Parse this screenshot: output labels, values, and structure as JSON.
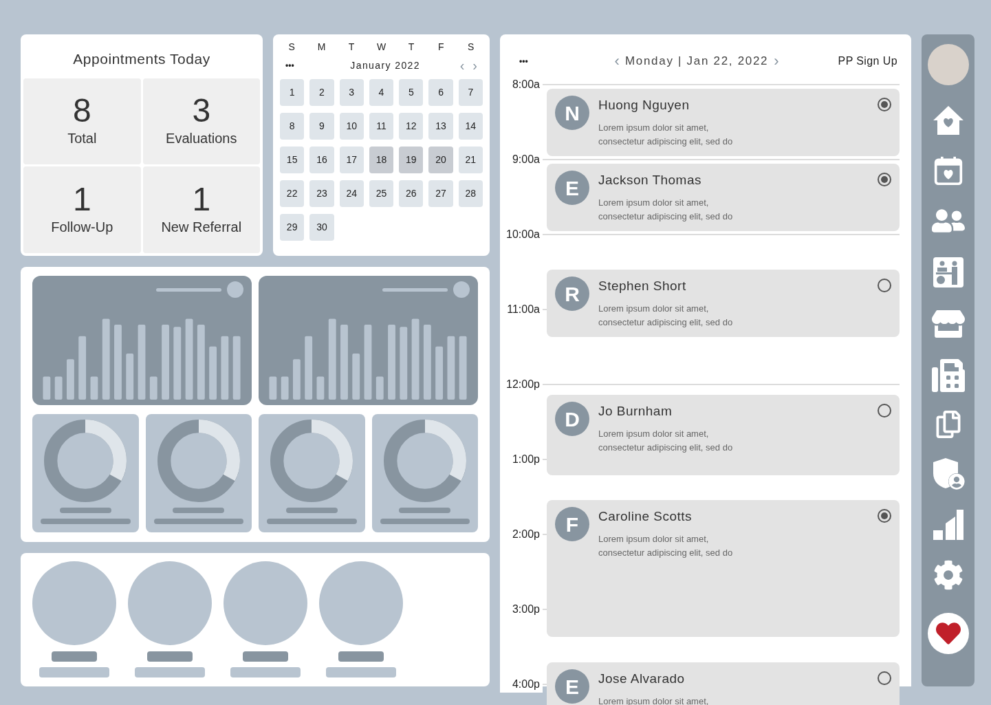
{
  "stats": {
    "title": "Appointments Today",
    "tiles": [
      {
        "value": "8",
        "label": "Total"
      },
      {
        "value": "3",
        "label": "Evaluations"
      },
      {
        "value": "1",
        "label": "Follow-Up"
      },
      {
        "value": "1",
        "label": "New Referral"
      }
    ]
  },
  "calendar": {
    "weekdays": [
      "S",
      "M",
      "T",
      "W",
      "T",
      "F",
      "S"
    ],
    "menu": "•••",
    "month": "January 2022",
    "prev": "‹",
    "next": "›",
    "days": [
      {
        "label": "1",
        "selected": false
      },
      {
        "label": "2",
        "selected": false
      },
      {
        "label": "3",
        "selected": false
      },
      {
        "label": "4",
        "selected": false
      },
      {
        "label": "5",
        "selected": false
      },
      {
        "label": "6",
        "selected": false
      },
      {
        "label": "7",
        "selected": false
      },
      {
        "label": "8",
        "selected": false
      },
      {
        "label": "9",
        "selected": false
      },
      {
        "label": "10",
        "selected": false
      },
      {
        "label": "11",
        "selected": false
      },
      {
        "label": "12",
        "selected": false
      },
      {
        "label": "13",
        "selected": false
      },
      {
        "label": "14",
        "selected": false
      },
      {
        "label": "15",
        "selected": false
      },
      {
        "label": "16",
        "selected": false
      },
      {
        "label": "17",
        "selected": false
      },
      {
        "label": "18",
        "selected": true
      },
      {
        "label": "19",
        "selected": true
      },
      {
        "label": "20",
        "selected": true
      },
      {
        "label": "21",
        "selected": false
      },
      {
        "label": "22",
        "selected": false
      },
      {
        "label": "23",
        "selected": false
      },
      {
        "label": "24",
        "selected": false
      },
      {
        "label": "25",
        "selected": false
      },
      {
        "label": "26",
        "selected": false
      },
      {
        "label": "27",
        "selected": false
      },
      {
        "label": "28",
        "selected": false
      },
      {
        "label": "29",
        "selected": false
      },
      {
        "label": "30",
        "selected": false
      }
    ]
  },
  "schedule": {
    "menu": "•••",
    "prev": "‹",
    "date": "Monday | Jan 22, 2022",
    "next": "›",
    "action": "PP Sign Up",
    "hours": [
      "8:00a",
      "9:00a",
      "10:00a",
      "11:00a",
      "12:00p",
      "1:00p",
      "2:00p",
      "3:00p",
      "4:00p"
    ],
    "appointments": [
      {
        "initial": "N",
        "name": "Huong Nguyen",
        "note": "Lorem ipsum dolor sit amet,\nconsectetur adipiscing elit, sed do",
        "checked": true
      },
      {
        "initial": "E",
        "name": "Jackson Thomas",
        "note": "Lorem ipsum dolor sit amet,\nconsectetur adipiscing elit, sed do",
        "checked": true
      },
      {
        "initial": "R",
        "name": "Stephen Short",
        "note": "Lorem ipsum dolor sit amet,\nconsectetur adipiscing elit, sed do",
        "checked": false
      },
      {
        "initial": "D",
        "name": "Jo Burnham",
        "note": "Lorem ipsum dolor sit amet,\nconsectetur adipiscing elit, sed do",
        "checked": false
      },
      {
        "initial": "F",
        "name": "Caroline Scotts",
        "note": "Lorem ipsum dolor sit amet,\nconsectetur adipiscing elit, sed do",
        "checked": true
      },
      {
        "initial": "E",
        "name": "Jose Alvarado",
        "note": "Lorem ipsum dolor sit amet,",
        "checked": false
      }
    ]
  }
}
